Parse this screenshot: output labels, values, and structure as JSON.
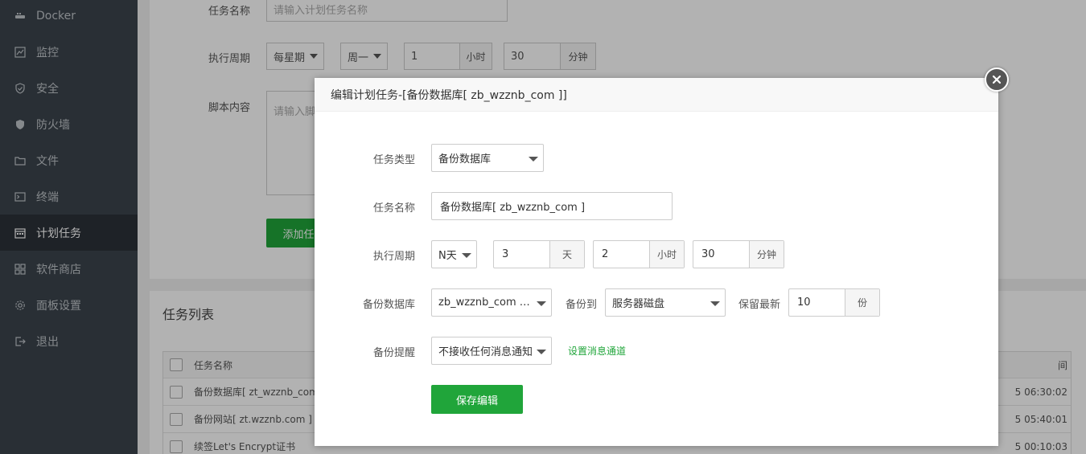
{
  "sidebar": {
    "items": [
      {
        "label": "Docker",
        "icon": "docker-icon"
      },
      {
        "label": "监控",
        "icon": "monitor-icon"
      },
      {
        "label": "安全",
        "icon": "shield-icon"
      },
      {
        "label": "防火墙",
        "icon": "firewall-icon"
      },
      {
        "label": "文件",
        "icon": "folder-icon"
      },
      {
        "label": "终端",
        "icon": "terminal-icon"
      },
      {
        "label": "计划任务",
        "icon": "calendar-icon",
        "active": true
      },
      {
        "label": "软件商店",
        "icon": "apps-icon"
      },
      {
        "label": "面板设置",
        "icon": "gear-icon"
      },
      {
        "label": "退出",
        "icon": "logout-icon"
      }
    ]
  },
  "background_form": {
    "task_name_label": "任务名称",
    "task_name_placeholder": "请输入计划任务名称",
    "period_label": "执行周期",
    "period_type": "每星期",
    "weekday": "周一",
    "hour_value": "1",
    "hour_unit": "小时",
    "minute_value": "30",
    "minute_unit": "分钟",
    "script_label": "脚本内容",
    "script_placeholder": "请输入脚",
    "add_button": "添加任"
  },
  "task_list": {
    "title": "任务列表",
    "header_name": "任务名称",
    "header_time": "间",
    "rows": [
      {
        "name": "备份数据库[ zt_wzznb_com",
        "time": "5 06:30:02"
      },
      {
        "name": "备份网站[ zt.wzznb.com ]",
        "time": "5 05:40:01"
      },
      {
        "name": "续签Let's Encrypt证书",
        "time": "5 00:10:03"
      }
    ]
  },
  "modal": {
    "title": "编辑计划任务-[备份数据库[ zb_wzznb_com ]]",
    "task_type_label": "任务类型",
    "task_type_value": "备份数据库",
    "task_name_label": "任务名称",
    "task_name_value": "备份数据库[ zb_wzznb_com ]",
    "period_label": "执行周期",
    "period_type": "N天",
    "days_value": "3",
    "days_unit": "天",
    "hours_value": "2",
    "hours_unit": "小时",
    "minutes_value": "30",
    "minutes_unit": "分钟",
    "db_label": "备份数据库",
    "db_value": "zb_wzznb_com [ zb_wzznb_com ]",
    "backup_to_label": "备份到",
    "backup_to_value": "服务器磁盘",
    "keep_label": "保留最新",
    "keep_value": "10",
    "keep_unit": "份",
    "notify_label": "备份提醒",
    "notify_value": "不接收任何消息通知",
    "notify_link": "设置消息通道",
    "save_button": "保存编辑"
  },
  "colors": {
    "accent": "#20a53a",
    "sidebar_bg": "#3c444d",
    "sidebar_active": "#2c3138"
  }
}
